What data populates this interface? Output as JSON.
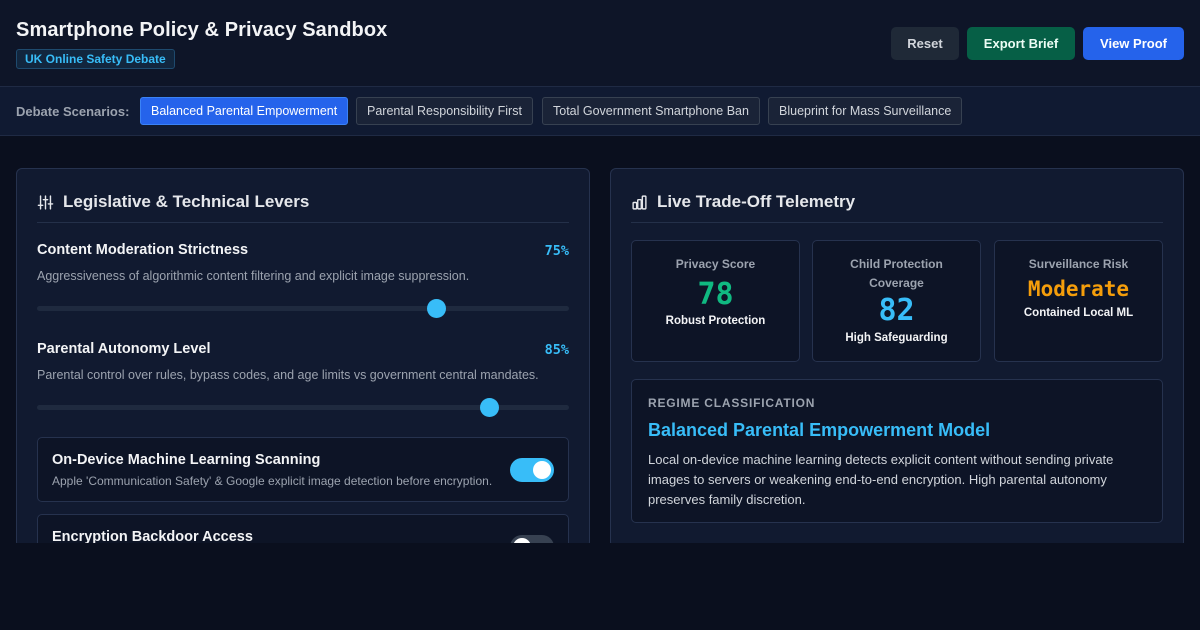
{
  "header": {
    "title": "Smartphone Policy & Privacy Sandbox",
    "badge": "UK Online Safety Debate",
    "buttons": {
      "reset": "Reset",
      "export": "Export Brief",
      "proof": "View Proof"
    }
  },
  "scenarios": {
    "label": "Debate Scenarios:",
    "items": [
      {
        "label": "Balanced Parental Empowerment",
        "active": true
      },
      {
        "label": "Parental Responsibility First",
        "active": false
      },
      {
        "label": "Total Government Smartphone Ban",
        "active": false
      },
      {
        "label": "Blueprint for Mass Surveillance",
        "active": false
      }
    ]
  },
  "levers_panel": {
    "title": "Legislative & Technical Levers",
    "icon": "sliders-icon",
    "sliders": [
      {
        "title": "Content Moderation Strictness",
        "value_text": "75%",
        "value": 75,
        "description": "Aggressiveness of algorithmic content filtering and explicit image suppression."
      },
      {
        "title": "Parental Autonomy Level",
        "value_text": "85%",
        "value": 85,
        "description": "Parental control over rules, bypass codes, and age limits vs government central mandates."
      }
    ],
    "toggles": [
      {
        "title": "On-Device Machine Learning Scanning",
        "description": "Apple 'Communication Safety' & Google explicit image detection before encryption.",
        "on": true
      },
      {
        "title": "Encryption Backdoor Access",
        "description": "",
        "on": false
      }
    ]
  },
  "telemetry_panel": {
    "title": "Live Trade-Off Telemetry",
    "icon": "bar-chart-icon",
    "metrics": [
      {
        "label": "Privacy Score",
        "value": "78",
        "sub": "Robust Protection",
        "color": "#10b981"
      },
      {
        "label": "Child Protection Coverage",
        "value": "82",
        "sub": "High Safeguarding",
        "color": "#38bdf8"
      },
      {
        "label": "Surveillance Risk",
        "value": "Moderate",
        "sub": "Contained Local ML",
        "color": "#f59e0b"
      }
    ],
    "regime": {
      "label": "REGIME CLASSIFICATION",
      "title": "Balanced Parental Empowerment Model",
      "description": "Local on-device machine learning detects explicit content without sending private images to servers or weakening end-to-end encryption. High parental autonomy preserves family discretion."
    }
  },
  "colors": {
    "accent": "#38bdf8",
    "primary": "#2563eb",
    "success": "#065f46",
    "warning": "#f59e0b",
    "good": "#10b981"
  }
}
